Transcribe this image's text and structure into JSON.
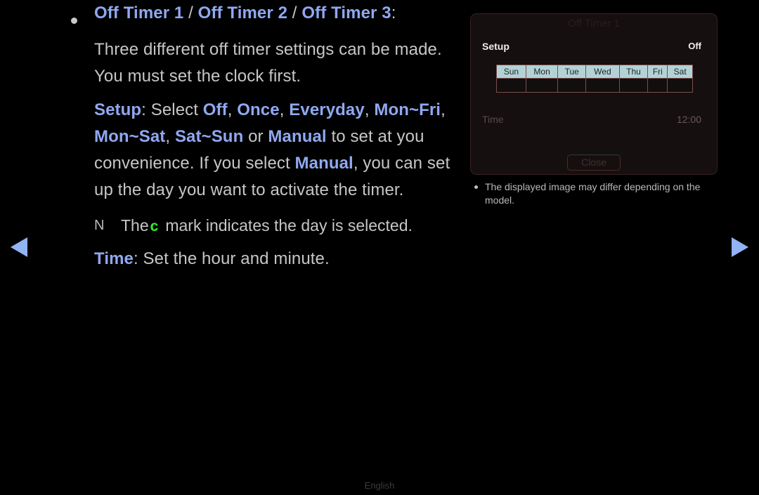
{
  "page": {
    "language_label": "English"
  },
  "nav": {
    "prev_label": "Previous page",
    "next_label": "Next page"
  },
  "content": {
    "heading": {
      "item1": "Off Timer 1",
      "item2": "Off Timer 2",
      "item3": "Off Timer 3",
      "separator": " / ",
      "colon": ":"
    },
    "lead_text": "Three different off timer settings can be made. You must set the clock first.",
    "setup": {
      "term": "Setup",
      "colon_select": ": Select ",
      "options": [
        "Off",
        "Once",
        "Everyday",
        "Mon~Fri",
        "Mon~Sat",
        "Sat~Sun"
      ],
      "comma": ", ",
      "or": " or ",
      "manual": "Manual",
      "tail": " to set at you convenience. If you select ",
      "tail2": ", you can set up the day you want to activate the timer."
    },
    "note": {
      "marker": "N",
      "before": "The",
      "mark_glyph": "c",
      "after": "mark indicates the day is selected."
    },
    "time": {
      "term": "Time",
      "desc": ": Set the hour and minute."
    }
  },
  "osd": {
    "title": "Off Timer 1",
    "setup_label": "Setup",
    "setup_value": "Off",
    "days": [
      "Sun",
      "Mon",
      "Tue",
      "Wed",
      "Thu",
      "Fri",
      "Sat"
    ],
    "time_label": "Time",
    "time_value": "12:00",
    "close_label": "Close"
  },
  "side_note": {
    "text": "The displayed image may differ depending on the model."
  },
  "colors": {
    "background": "#000000",
    "body_text": "#c6c6c6",
    "accent_blue": "#8fa8f0",
    "arrow_blue": "#92b4f4",
    "check_green": "#2ef32e",
    "osd_background": "#150f0f",
    "day_header": "#b3d2d6",
    "cell_border": "#7b4c4c"
  }
}
